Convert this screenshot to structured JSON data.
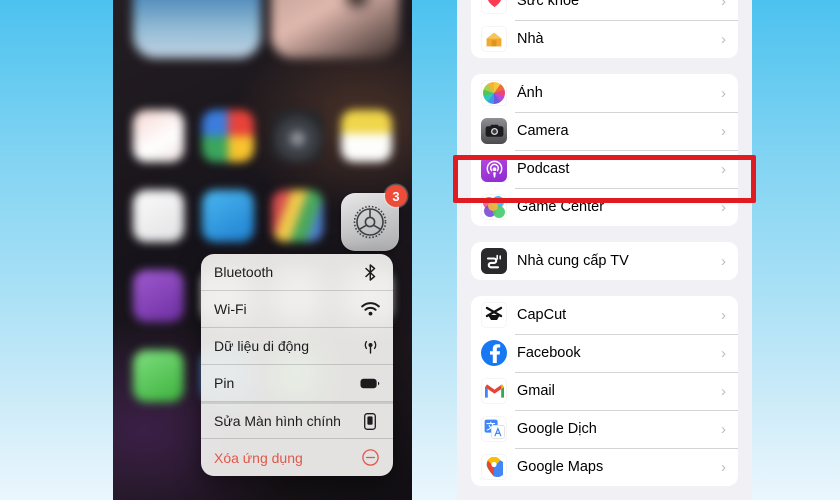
{
  "background": {
    "sky_top": "#4cc2ef",
    "sky_bottom": "#eaf6fd"
  },
  "phone_home": {
    "settings_app": {
      "name": "Settings",
      "badge_count": "3"
    },
    "context_menu": {
      "items": [
        {
          "label": "Bluetooth",
          "icon": "bluetooth-icon",
          "destructive": false
        },
        {
          "label": "Wi-Fi",
          "icon": "wifi-icon",
          "destructive": false
        },
        {
          "label": "Dữ liệu di động",
          "icon": "cellular-data-icon",
          "destructive": false
        },
        {
          "label": "Pin",
          "icon": "battery-icon",
          "destructive": false
        },
        {
          "label": "Sửa Màn hình chính",
          "icon": "edit-home-screen-icon",
          "destructive": false
        },
        {
          "label": "Xóa ứng dụng",
          "icon": "remove-app-icon",
          "destructive": true
        }
      ]
    }
  },
  "settings_list": {
    "highlight_color": "#e01b22",
    "highlighted_row": "Podcast",
    "groups": [
      {
        "rows": [
          {
            "label": "Sức khỏe",
            "icon": "health-icon",
            "partial": true
          },
          {
            "label": "Nhà",
            "icon": "home-icon",
            "partial": false
          }
        ]
      },
      {
        "rows": [
          {
            "label": "Ảnh",
            "icon": "photos-icon",
            "partial": false
          },
          {
            "label": "Camera",
            "icon": "camera-icon",
            "partial": false
          },
          {
            "label": "Podcast",
            "icon": "podcast-icon",
            "partial": false
          },
          {
            "label": "Game Center",
            "icon": "game-center-icon",
            "partial": false
          }
        ]
      },
      {
        "rows": [
          {
            "label": "Nhà cung cấp TV",
            "icon": "tv-provider-icon",
            "partial": false
          }
        ]
      },
      {
        "rows": [
          {
            "label": "CapCut",
            "icon": "capcut-icon",
            "partial": false
          },
          {
            "label": "Facebook",
            "icon": "facebook-icon",
            "partial": false
          },
          {
            "label": "Gmail",
            "icon": "gmail-icon",
            "partial": false
          },
          {
            "label": "Google Dịch",
            "icon": "google-translate-icon",
            "partial": false
          },
          {
            "label": "Google Maps",
            "icon": "google-maps-icon",
            "partial": true
          }
        ]
      }
    ],
    "chevron": "›"
  }
}
